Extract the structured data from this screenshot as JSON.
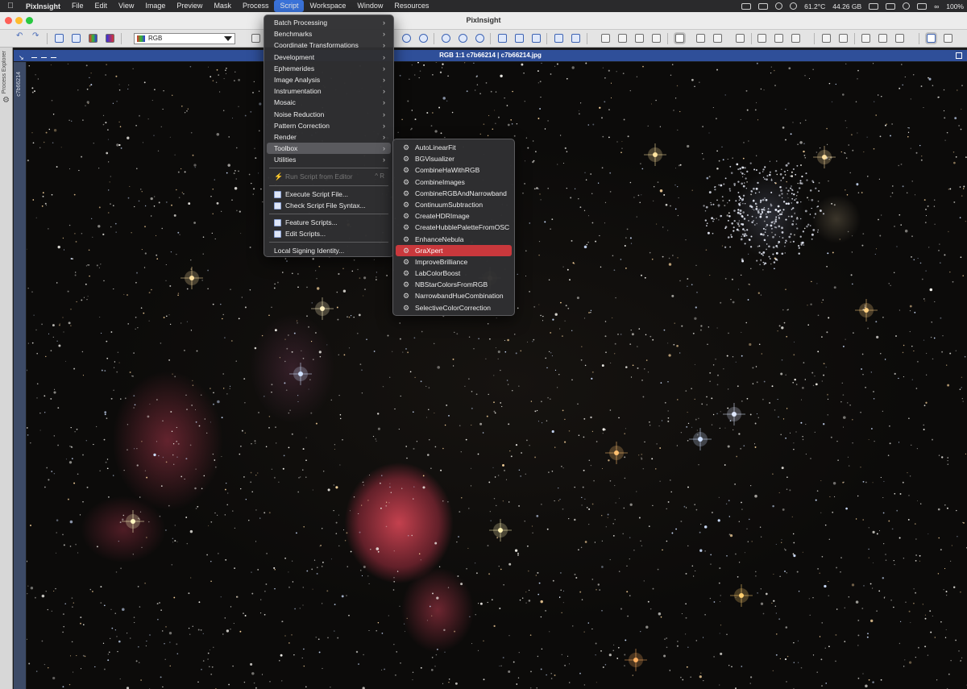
{
  "menubar": {
    "app_name": "PixInsight",
    "menus": [
      "File",
      "Edit",
      "View",
      "Image",
      "Preview",
      "Mask",
      "Process",
      "Script",
      "Workspace",
      "Window",
      "Resources"
    ],
    "active_menu": "Script",
    "status": {
      "temperature": "61.2°C",
      "memory": "44.26 GB",
      "battery": "100%"
    }
  },
  "window": {
    "title": "PixInsight"
  },
  "toolbar": {
    "channel_select": "RGB"
  },
  "sidebar": {
    "process_explorer": "Process Explorer",
    "view_tab": "c7b66214"
  },
  "image_window": {
    "title": "RGB 1:1 c7b66214 | c7b66214.jpg"
  },
  "script_menu": {
    "items": [
      {
        "label": "Batch Processing",
        "submenu": true
      },
      {
        "label": "Benchmarks",
        "submenu": true
      },
      {
        "label": "Coordinate Transformations",
        "submenu": true
      },
      {
        "label": "Development",
        "submenu": true
      },
      {
        "label": "Ephemerides",
        "submenu": true
      },
      {
        "label": "Image Analysis",
        "submenu": true
      },
      {
        "label": "Instrumentation",
        "submenu": true
      },
      {
        "label": "Mosaic",
        "submenu": true
      },
      {
        "label": "Noise Reduction",
        "submenu": true
      },
      {
        "label": "Pattern Correction",
        "submenu": true
      },
      {
        "label": "Render",
        "submenu": true
      },
      {
        "label": "Toolbox",
        "submenu": true
      },
      {
        "label": "Utilities",
        "submenu": true
      }
    ],
    "run_script": {
      "label": "Run Script from Editor",
      "shortcut": "^ R"
    },
    "execute": "Execute Script File...",
    "check_syntax": "Check Script File Syntax...",
    "feature_scripts": "Feature Scripts...",
    "edit_scripts": "Edit Scripts...",
    "signing": "Local Signing Identity..."
  },
  "toolbox_menu": {
    "items": [
      "AutoLinearFit",
      "BGVisualizer",
      "CombineHaWithRGB",
      "CombineImages",
      "CombineRGBAndNarrowband",
      "ContinuumSubtraction",
      "CreateHDRImage",
      "CreateHubblePaletteFromOSC",
      "EnhanceNebula",
      "GraXpert",
      "ImproveBrilliance",
      "LabColorBoost",
      "NBStarColorsFromRGB",
      "NarrowbandHueCombination",
      "SelectiveColorCorrection"
    ],
    "highlighted": "GraXpert"
  },
  "colors": {
    "highlight": "#c9383c",
    "image_title_bar": "#2f4f99",
    "menu_bg": "#303032"
  }
}
